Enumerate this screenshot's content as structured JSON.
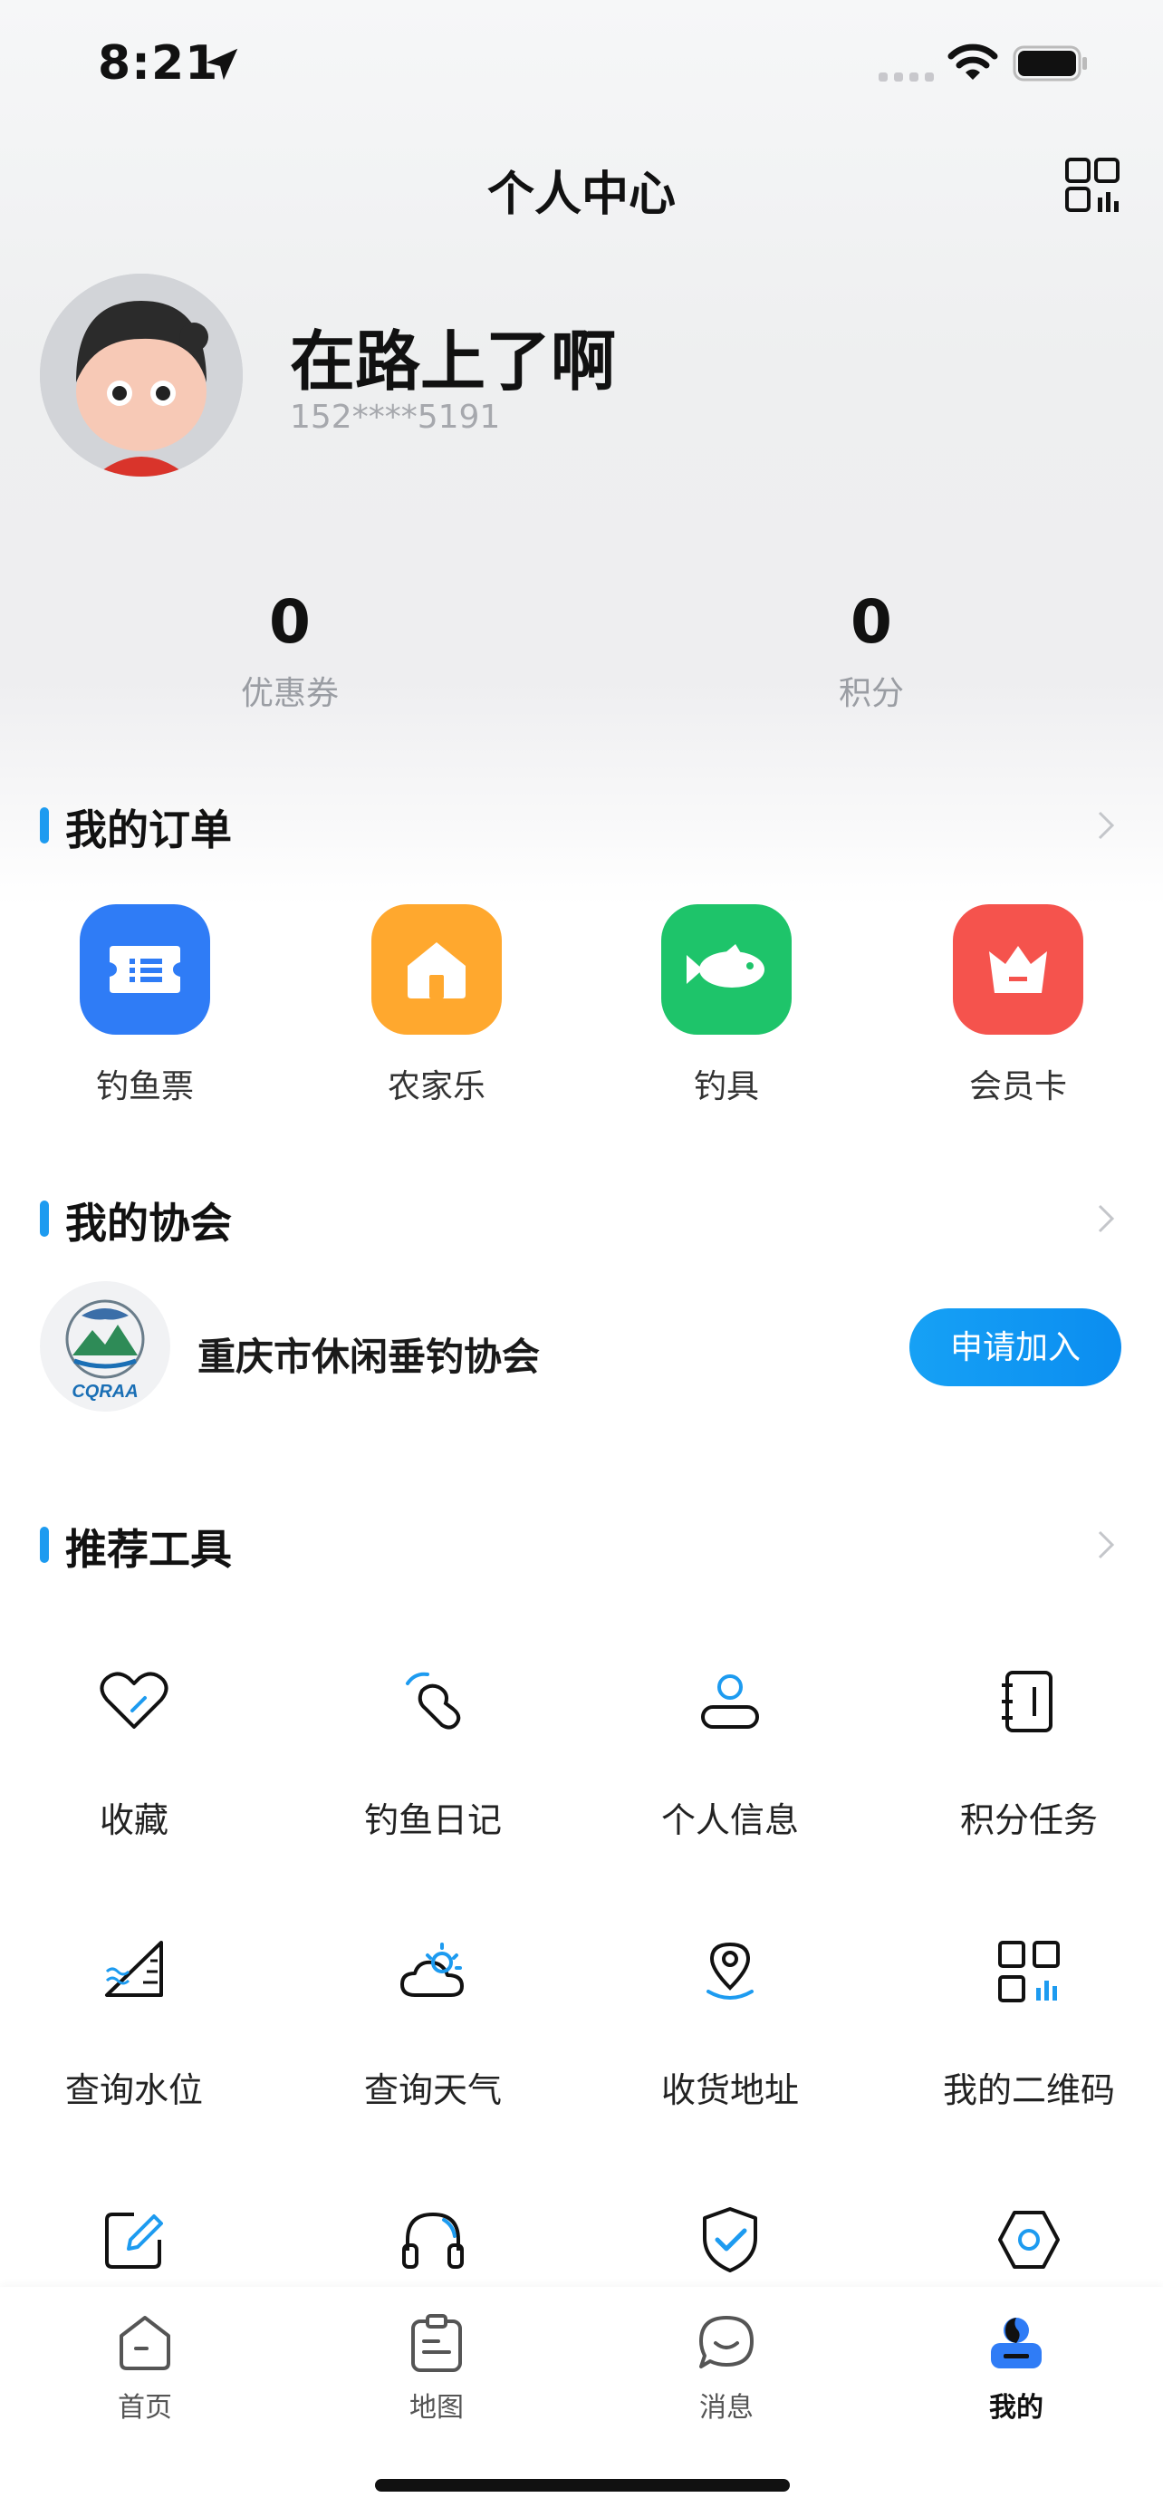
{
  "status_bar": {
    "time": "8:21"
  },
  "header": {
    "title": "个人中心"
  },
  "profile": {
    "name": "在路上了啊",
    "phone": "152****5191"
  },
  "stats": [
    {
      "value": "0",
      "label": "优惠券"
    },
    {
      "value": "0",
      "label": "积分"
    }
  ],
  "orders": {
    "title": "我的订单",
    "items": [
      {
        "label": "钓鱼票",
        "icon": "ticket-icon",
        "color": "#2f7cf6"
      },
      {
        "label": "农家乐",
        "icon": "house-icon",
        "color": "#ffa82e"
      },
      {
        "label": "钓具",
        "icon": "fish-icon",
        "color": "#1ec46a"
      },
      {
        "label": "会员卡",
        "icon": "crown-icon",
        "color": "#f5534d"
      }
    ]
  },
  "association": {
    "title": "我的协会",
    "name": "重庆市休闲垂钓协会",
    "logo_text": "CQRAA",
    "join_label": "申请加入"
  },
  "tools": {
    "title": "推荐工具",
    "items": [
      {
        "label": "收藏",
        "icon": "heart-icon"
      },
      {
        "label": "钓鱼日记",
        "icon": "fishing-diary-icon"
      },
      {
        "label": "个人信息",
        "icon": "user-icon"
      },
      {
        "label": "积分任务",
        "icon": "notebook-icon"
      },
      {
        "label": "查询水位",
        "icon": "water-level-icon"
      },
      {
        "label": "查询天气",
        "icon": "weather-icon"
      },
      {
        "label": "收货地址",
        "icon": "location-pin-icon"
      },
      {
        "label": "我的二维码",
        "icon": "qr-code-icon"
      },
      {
        "label": "",
        "icon": "edit-icon"
      },
      {
        "label": "",
        "icon": "headphones-icon"
      },
      {
        "label": "",
        "icon": "shield-check-icon"
      },
      {
        "label": "",
        "icon": "hexagon-settings-icon"
      }
    ]
  },
  "tabbar": {
    "items": [
      {
        "label": "首页",
        "icon": "home-icon"
      },
      {
        "label": "地图",
        "icon": "map-icon"
      },
      {
        "label": "消息",
        "icon": "message-icon"
      },
      {
        "label": "我的",
        "icon": "profile-icon",
        "active": true
      }
    ]
  },
  "accent_color": "#1d9bf0"
}
